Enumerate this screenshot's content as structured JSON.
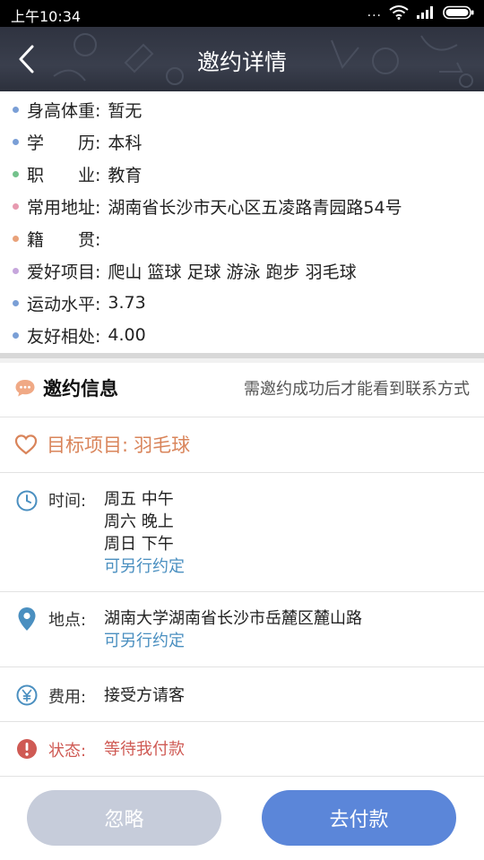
{
  "status_bar": {
    "time": "上午10:34",
    "dots": "..."
  },
  "nav": {
    "title": "邀约详情"
  },
  "profile": {
    "items": [
      {
        "label": "身高体重:",
        "value": "暂无",
        "color": "#7a9fd6"
      },
      {
        "label": "学　　历:",
        "value": "本科",
        "color": "#7a9fd6"
      },
      {
        "label": "职　　业:",
        "value": "教育",
        "color": "#74c28c"
      },
      {
        "label": "常用地址:",
        "value": "湖南省长沙市天心区五凌路青园路54号",
        "color": "#e79ab0"
      },
      {
        "label": "籍　　贯:",
        "value": "",
        "color": "#e9a27a"
      },
      {
        "label": "爱好项目:",
        "value": "爬山 篮球 足球 游泳 跑步 羽毛球",
        "color": "#c6a6dc"
      },
      {
        "label": "运动水平:",
        "value": "3.73",
        "color": "#7a9fd6"
      },
      {
        "label": "友好相处:",
        "value": "4.00",
        "color": "#7a9fd6"
      }
    ]
  },
  "invite": {
    "title": "邀约信息",
    "note": "需邀约成功后才能看到联系方式",
    "target_label": "目标项目:",
    "target_value": "羽毛球",
    "time_label": "时间:",
    "time_values": [
      "周五 中午",
      "周六 晚上",
      "周日 下午"
    ],
    "time_flex": "可另行约定",
    "place_label": "地点:",
    "place_value": "湖南大学湖南省长沙市岳麓区麓山路",
    "place_flex": "可另行约定",
    "fee_label": "费用:",
    "fee_value": "接受方请客",
    "state_label": "状态:",
    "state_value": "等待我付款"
  },
  "actions": {
    "ignore": "忽略",
    "pay": "去付款"
  },
  "colors": {
    "accent_blue": "#5b86d9",
    "orange": "#d9845a",
    "red": "#cf5a54",
    "link_blue": "#4a8fc0"
  }
}
